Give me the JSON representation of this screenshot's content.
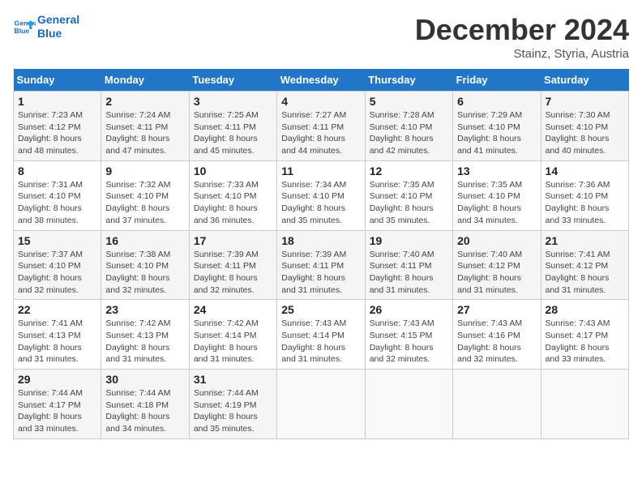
{
  "logo": {
    "line1": "General",
    "line2": "Blue"
  },
  "title": "December 2024",
  "subtitle": "Stainz, Styria, Austria",
  "headers": [
    "Sunday",
    "Monday",
    "Tuesday",
    "Wednesday",
    "Thursday",
    "Friday",
    "Saturday"
  ],
  "weeks": [
    [
      {
        "day": "1",
        "sunrise": "7:23 AM",
        "sunset": "4:12 PM",
        "daylight": "8 hours and 48 minutes."
      },
      {
        "day": "2",
        "sunrise": "7:24 AM",
        "sunset": "4:11 PM",
        "daylight": "8 hours and 47 minutes."
      },
      {
        "day": "3",
        "sunrise": "7:25 AM",
        "sunset": "4:11 PM",
        "daylight": "8 hours and 45 minutes."
      },
      {
        "day": "4",
        "sunrise": "7:27 AM",
        "sunset": "4:11 PM",
        "daylight": "8 hours and 44 minutes."
      },
      {
        "day": "5",
        "sunrise": "7:28 AM",
        "sunset": "4:10 PM",
        "daylight": "8 hours and 42 minutes."
      },
      {
        "day": "6",
        "sunrise": "7:29 AM",
        "sunset": "4:10 PM",
        "daylight": "8 hours and 41 minutes."
      },
      {
        "day": "7",
        "sunrise": "7:30 AM",
        "sunset": "4:10 PM",
        "daylight": "8 hours and 40 minutes."
      }
    ],
    [
      {
        "day": "8",
        "sunrise": "7:31 AM",
        "sunset": "4:10 PM",
        "daylight": "8 hours and 38 minutes."
      },
      {
        "day": "9",
        "sunrise": "7:32 AM",
        "sunset": "4:10 PM",
        "daylight": "8 hours and 37 minutes."
      },
      {
        "day": "10",
        "sunrise": "7:33 AM",
        "sunset": "4:10 PM",
        "daylight": "8 hours and 36 minutes."
      },
      {
        "day": "11",
        "sunrise": "7:34 AM",
        "sunset": "4:10 PM",
        "daylight": "8 hours and 35 minutes."
      },
      {
        "day": "12",
        "sunrise": "7:35 AM",
        "sunset": "4:10 PM",
        "daylight": "8 hours and 35 minutes."
      },
      {
        "day": "13",
        "sunrise": "7:35 AM",
        "sunset": "4:10 PM",
        "daylight": "8 hours and 34 minutes."
      },
      {
        "day": "14",
        "sunrise": "7:36 AM",
        "sunset": "4:10 PM",
        "daylight": "8 hours and 33 minutes."
      }
    ],
    [
      {
        "day": "15",
        "sunrise": "7:37 AM",
        "sunset": "4:10 PM",
        "daylight": "8 hours and 32 minutes."
      },
      {
        "day": "16",
        "sunrise": "7:38 AM",
        "sunset": "4:10 PM",
        "daylight": "8 hours and 32 minutes."
      },
      {
        "day": "17",
        "sunrise": "7:39 AM",
        "sunset": "4:11 PM",
        "daylight": "8 hours and 32 minutes."
      },
      {
        "day": "18",
        "sunrise": "7:39 AM",
        "sunset": "4:11 PM",
        "daylight": "8 hours and 31 minutes."
      },
      {
        "day": "19",
        "sunrise": "7:40 AM",
        "sunset": "4:11 PM",
        "daylight": "8 hours and 31 minutes."
      },
      {
        "day": "20",
        "sunrise": "7:40 AM",
        "sunset": "4:12 PM",
        "daylight": "8 hours and 31 minutes."
      },
      {
        "day": "21",
        "sunrise": "7:41 AM",
        "sunset": "4:12 PM",
        "daylight": "8 hours and 31 minutes."
      }
    ],
    [
      {
        "day": "22",
        "sunrise": "7:41 AM",
        "sunset": "4:13 PM",
        "daylight": "8 hours and 31 minutes."
      },
      {
        "day": "23",
        "sunrise": "7:42 AM",
        "sunset": "4:13 PM",
        "daylight": "8 hours and 31 minutes."
      },
      {
        "day": "24",
        "sunrise": "7:42 AM",
        "sunset": "4:14 PM",
        "daylight": "8 hours and 31 minutes."
      },
      {
        "day": "25",
        "sunrise": "7:43 AM",
        "sunset": "4:14 PM",
        "daylight": "8 hours and 31 minutes."
      },
      {
        "day": "26",
        "sunrise": "7:43 AM",
        "sunset": "4:15 PM",
        "daylight": "8 hours and 32 minutes."
      },
      {
        "day": "27",
        "sunrise": "7:43 AM",
        "sunset": "4:16 PM",
        "daylight": "8 hours and 32 minutes."
      },
      {
        "day": "28",
        "sunrise": "7:43 AM",
        "sunset": "4:17 PM",
        "daylight": "8 hours and 33 minutes."
      }
    ],
    [
      {
        "day": "29",
        "sunrise": "7:44 AM",
        "sunset": "4:17 PM",
        "daylight": "8 hours and 33 minutes."
      },
      {
        "day": "30",
        "sunrise": "7:44 AM",
        "sunset": "4:18 PM",
        "daylight": "8 hours and 34 minutes."
      },
      {
        "day": "31",
        "sunrise": "7:44 AM",
        "sunset": "4:19 PM",
        "daylight": "8 hours and 35 minutes."
      },
      null,
      null,
      null,
      null
    ]
  ],
  "labels": {
    "sunrise": "Sunrise:",
    "sunset": "Sunset:",
    "daylight": "Daylight:"
  }
}
